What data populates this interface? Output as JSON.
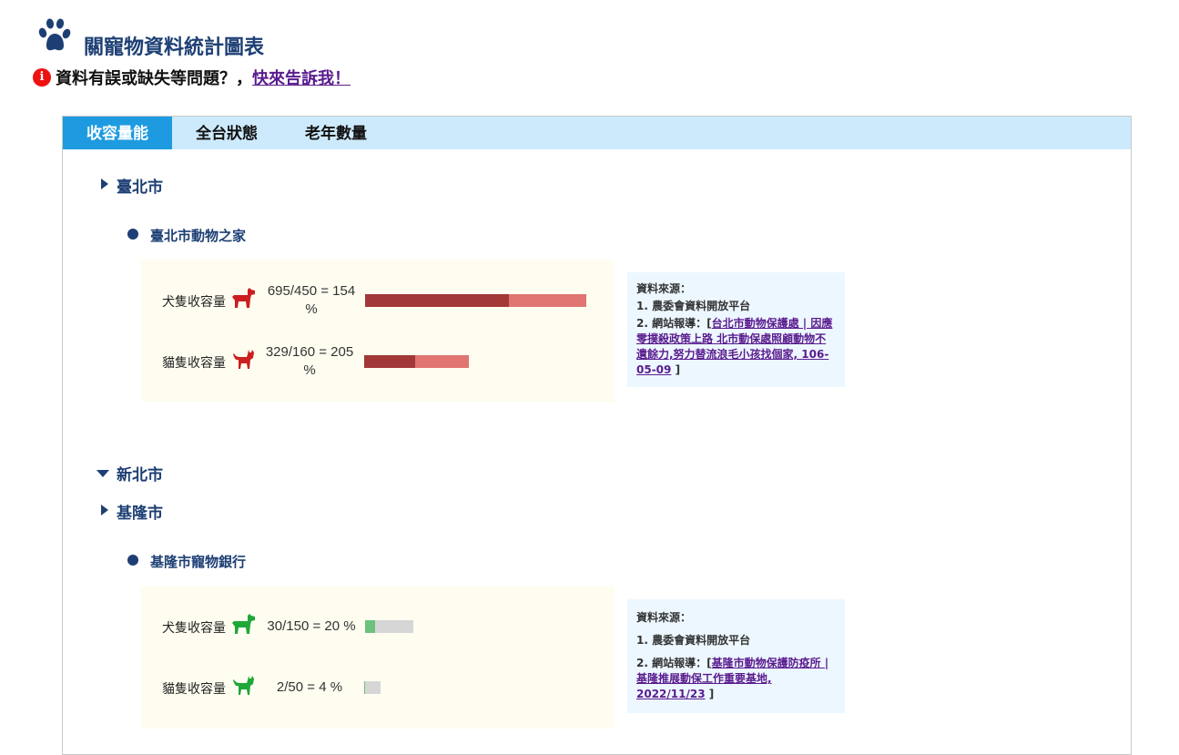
{
  "page": {
    "title": "關寵物資料統計圖表",
    "feedback_prefix": "資料有誤或缺失等問題？，",
    "feedback_link": "快來告訴我！",
    "alert_icon_glyph": "i"
  },
  "tabs": [
    {
      "label": "收容量能",
      "active": true
    },
    {
      "label": "全台狀態",
      "active": false
    },
    {
      "label": "老年數量",
      "active": false
    }
  ],
  "regions": [
    {
      "name": "臺北市",
      "expanded": true,
      "shelters": [
        {
          "name": "臺北市動物之家",
          "dog": {
            "label": "犬隻收容量",
            "ratio_text": "695/450 = 154 %",
            "percent": 154,
            "icon": "dog-icon",
            "icon_color": "#cc1f1f"
          },
          "cat": {
            "label": "貓隻收容量",
            "ratio_text": "329/160 = 205 %",
            "percent": 205,
            "icon": "cat-icon",
            "icon_color": "#cc1f1f"
          },
          "source": {
            "heading": "資料來源：",
            "item1": "1. 農委會資料開放平台",
            "item2_prefix": "2. 網站報導：[",
            "item2_link": "台北市動物保護處 | 因應零撲殺政策上路 北市動保處照顧動物不遺餘力,努力替流浪毛小孩找個家, 106-05-09",
            "item2_suffix": " ]"
          }
        }
      ]
    },
    {
      "name": "新北市",
      "expanded": false,
      "shelters": []
    },
    {
      "name": "基隆市",
      "expanded": true,
      "shelters": [
        {
          "name": "基隆市寵物銀行",
          "dog": {
            "label": "犬隻收容量",
            "ratio_text": "30/150 = 20 %",
            "percent": 20,
            "icon": "dog-icon",
            "icon_color": "#1fa83a"
          },
          "cat": {
            "label": "貓隻收容量",
            "ratio_text": "2/50 = 4 %",
            "percent": 4,
            "icon": "cat-icon",
            "icon_color": "#1fa83a"
          },
          "source": {
            "heading": "資料來源：",
            "item1": "1. 農委會資料開放平台",
            "item2_prefix": "2. 網站報導：[",
            "item2_link": "基隆市動物保護防疫所 | 基隆推展動保工作重要基地, 2022/11/23",
            "item2_suffix": " ]"
          }
        }
      ]
    }
  ],
  "colors": {
    "over_dark": "#a23838",
    "over_light": "#e07572",
    "under_fill": "#6cc27a",
    "track": "#d6d6d6",
    "heading": "#1d3f74",
    "tab_active": "#1e9be0",
    "tab_bar": "#cdeafc"
  }
}
